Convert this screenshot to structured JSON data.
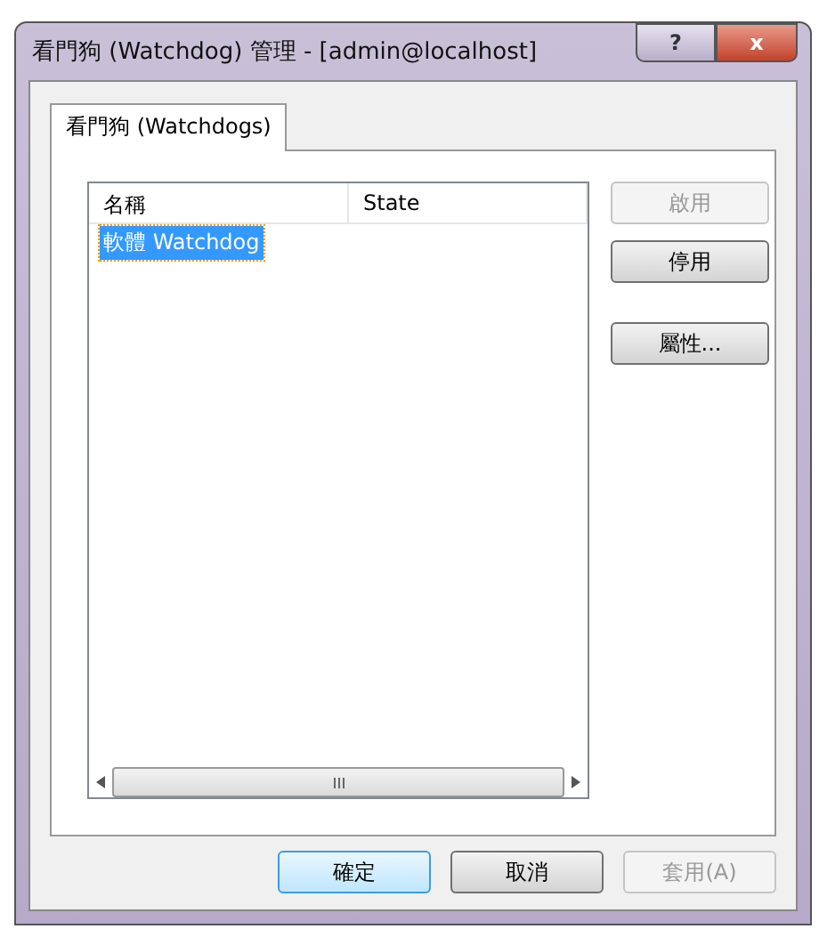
{
  "window": {
    "title": "看門狗 (Watchdog) 管理 - [admin@localhost]",
    "help": "?",
    "close": "x"
  },
  "tabs": [
    {
      "label": "看門狗 (Watchdogs)",
      "selected": true
    }
  ],
  "list": {
    "columns": [
      "名稱",
      "State"
    ],
    "rows": [
      {
        "cells": [
          "軟體 Watchdog",
          ""
        ],
        "selected": true
      }
    ]
  },
  "side_buttons": [
    {
      "label": "啟用",
      "disabled": true
    },
    {
      "label": "停用",
      "disabled": false
    },
    {
      "label": "屬性...",
      "disabled": false
    }
  ],
  "buttons": [
    {
      "label": "確定",
      "disabled": false,
      "default": true
    },
    {
      "label": "取消",
      "disabled": false,
      "default": false
    },
    {
      "label": "套用(A)",
      "disabled": true,
      "default": false
    }
  ]
}
